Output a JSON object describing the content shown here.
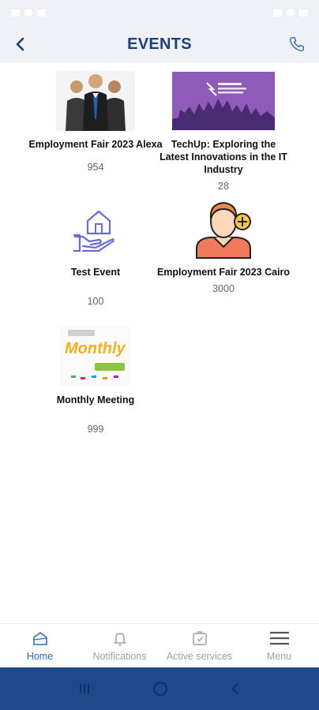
{
  "header": {
    "title": "EVENTS"
  },
  "events": [
    {
      "name": "Employment Fair 2023 Alexa",
      "count": "954"
    },
    {
      "name": "TechUp: Exploring the Latest Innovations in the IT Industry",
      "count": "28"
    },
    {
      "name": "Test Event",
      "count": "100"
    },
    {
      "name": "Employment Fair 2023 Cairo",
      "count": "3000"
    },
    {
      "name": "Monthly Meeting",
      "count": "999"
    }
  ],
  "bottom_nav": [
    {
      "label": "Home",
      "icon": "home-icon",
      "active": true
    },
    {
      "label": "Notifications",
      "icon": "bell-icon",
      "active": false
    },
    {
      "label": "Active services",
      "icon": "services-icon",
      "active": false
    },
    {
      "label": "Menu",
      "icon": "menu-icon",
      "active": false
    }
  ],
  "colors": {
    "brand": "#1d3f7a",
    "accent": "#2c6bb8",
    "system_nav": "#1e4a8c"
  }
}
